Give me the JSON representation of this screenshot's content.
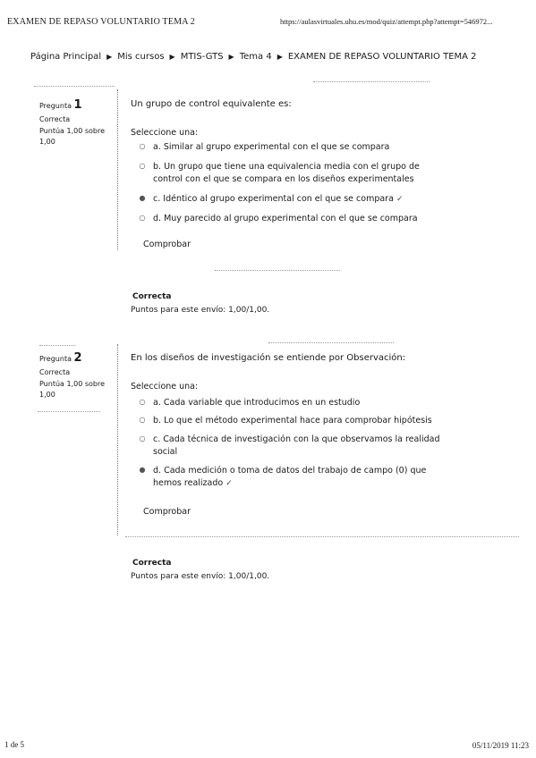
{
  "header": {
    "title": "EXAMEN DE REPASO VOLUNTARIO TEMA 2",
    "url": "https://aulasvirtuales.uhu.es/mod/quiz/attempt.php?attempt=546972..."
  },
  "breadcrumb": [
    "Página Principal",
    "Mis cursos",
    "MTIS-GTS",
    "Tema 4",
    "EXAMEN DE REPASO VOLUNTARIO TEMA 2"
  ],
  "breadcrumb_separator": "▶",
  "questions": [
    {
      "label": "Pregunta",
      "number": "1",
      "state": "Correcta",
      "grade_line1": "Puntúa 1,00 sobre",
      "grade_line2": "1,00",
      "text": "Un grupo de control equivalente es:",
      "prompt": "Seleccione una:",
      "answers": [
        {
          "text": "a. Similar al grupo experimental con el que se compara",
          "marker": "○",
          "tick": ""
        },
        {
          "text": "b. Un grupo que tiene una equivalencia media con el grupo de control con el que se compara en los diseños experimentales",
          "marker": "○",
          "tick": ""
        },
        {
          "text": "c. Idéntico al grupo experimental con el que se compara",
          "marker": "●",
          "tick": "✓"
        },
        {
          "text": "d. Muy parecido al grupo experimental con el que se compara",
          "marker": "○",
          "tick": ""
        }
      ],
      "check_label": "Comprobar",
      "feedback_title": "Correcta",
      "feedback_points": "Puntos para este envío: 1,00/1,00."
    },
    {
      "label": "Pregunta",
      "number": "2",
      "state": "Correcta",
      "grade_line1": "Puntúa 1,00 sobre",
      "grade_line2": "1,00",
      "text": "En los diseños de investigación se entiende por Observación:",
      "prompt": "Seleccione una:",
      "answers": [
        {
          "text": "a. Cada variable que introducimos en un estudio",
          "marker": "○",
          "tick": ""
        },
        {
          "text": "b. Lo que el método experimental hace para comprobar hipótesis",
          "marker": "○",
          "tick": ""
        },
        {
          "text": "c. Cada técnica de investigación con la que observamos la realidad social",
          "marker": "○",
          "tick": ""
        },
        {
          "text": "d. Cada medición o toma de datos del trabajo de campo (0) que hemos realizado",
          "marker": "●",
          "tick": "✓"
        }
      ],
      "check_label": "Comprobar",
      "feedback_title": "Correcta",
      "feedback_points": "Puntos para este envío: 1,00/1,00."
    }
  ],
  "footer": {
    "page": "1 de 5",
    "datetime": "05/11/2019 11:23"
  }
}
